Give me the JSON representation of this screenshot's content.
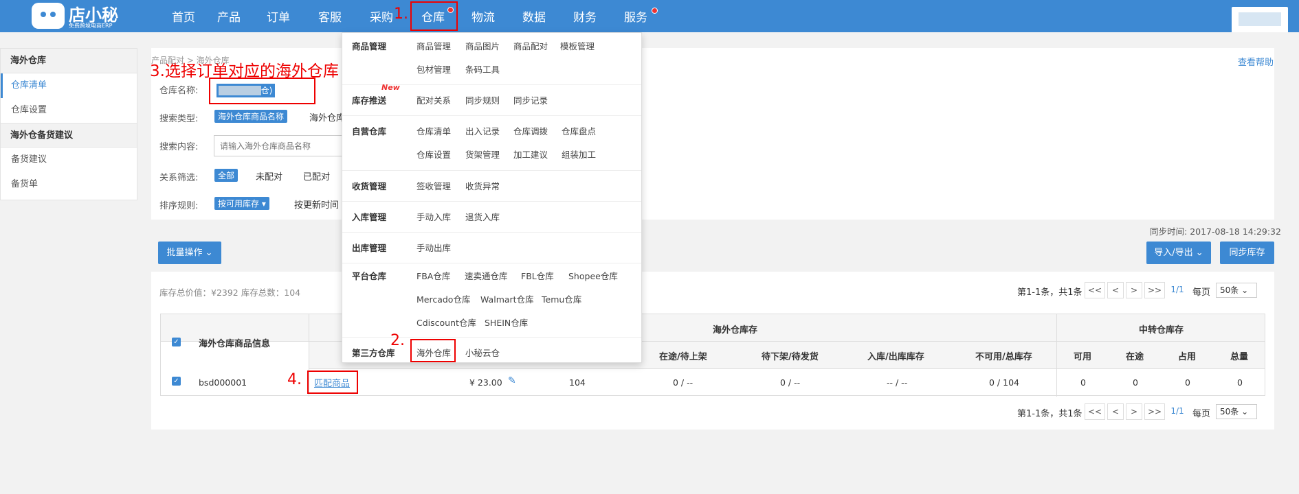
{
  "brand": {
    "name": "店小秘",
    "tagline": "免费跨境电商ERP"
  },
  "nav": {
    "items": [
      "首页",
      "产品",
      "订单",
      "客服",
      "采购",
      "仓库",
      "物流",
      "数据",
      "财务",
      "服务"
    ]
  },
  "sidebar": {
    "groups": [
      {
        "title": "海外仓库",
        "items": [
          "仓库清单",
          "仓库设置"
        ]
      },
      {
        "title": "海外仓备货建议",
        "items": [
          "备货建议",
          "备货单"
        ]
      }
    ]
  },
  "breadcrumb": "产品配对 > 海外仓库",
  "help": "查看帮助",
  "filters": {
    "warehouse_label": "仓库名称:",
    "warehouse_value": "(俄罗斯仓)",
    "search_type_label": "搜索类型:",
    "search_type_active": "海外仓库商品名称",
    "search_type_other": "海外仓库",
    "search_content_label": "搜索内容:",
    "search_placeholder": "请输入海外仓库商品名称",
    "relation_label": "关系筛选:",
    "relation_options": [
      "全部",
      "未配对",
      "已配对"
    ],
    "sort_label": "排序规则:",
    "sort_active": "按可用库存 ▾",
    "sort_other": "按更新时间"
  },
  "annotations": {
    "step1": "1.",
    "step2": "2.",
    "step3": "3.选择订单对应的海外仓库",
    "step4": "4."
  },
  "sync": {
    "label": "同步时间:",
    "time": "2017-08-18 14:29:32"
  },
  "actions": {
    "batch": "批量操作 ⌄",
    "import_export": "导入/导出 ⌄",
    "sync_stock": "同步库存"
  },
  "summary": "库存总价值：¥2392  库存总数：104",
  "pager": {
    "info": "第1-1条，共1条",
    "first": "<<",
    "prev": "<",
    "next": ">",
    "last": ">>",
    "current": "1/1",
    "per_page_label": "每页",
    "per_page": "50条 ⌄"
  },
  "table": {
    "header_product": "海外仓库商品信息",
    "group_overseas": "海外仓库存",
    "group_transit": "中转仓库存",
    "sub_overseas": [
      "在途/待上架",
      "待下架/待发货",
      "入库/出库库存",
      "不可用/总库存"
    ],
    "sub_transit": [
      "可用",
      "在途",
      "占用",
      "总量"
    ],
    "rows": [
      {
        "sku": "bsd000001",
        "match": "匹配商品",
        "price": "¥ 23.00",
        "available": "104",
        "in_transit": "0 / --",
        "pending": "0 / --",
        "in_out": "-- / --",
        "unavailable_total": "0 / 104",
        "t_available": "0",
        "t_transit": "0",
        "t_occupied": "0",
        "t_total": "0"
      }
    ]
  },
  "dropdown": {
    "sections": [
      {
        "title": "商品管理",
        "rows": [
          [
            "商品管理",
            "商品图片",
            "商品配对",
            "模板管理"
          ],
          [
            "包材管理",
            "条码工具"
          ]
        ]
      },
      {
        "title": "库存推送",
        "badge": "New",
        "rows": [
          [
            "配对关系",
            "同步规则",
            "同步记录"
          ]
        ]
      },
      {
        "title": "自营仓库",
        "rows": [
          [
            "仓库清单",
            "出入记录",
            "仓库调拨",
            "仓库盘点"
          ],
          [
            "仓库设置",
            "货架管理",
            "加工建议",
            "组装加工"
          ]
        ]
      },
      {
        "title": "收货管理",
        "rows": [
          [
            "签收管理",
            "收货异常"
          ]
        ]
      },
      {
        "title": "入库管理",
        "rows": [
          [
            "手动入库",
            "退货入库"
          ]
        ]
      },
      {
        "title": "出库管理",
        "rows": [
          [
            "手动出库"
          ]
        ]
      },
      {
        "title": "平台仓库",
        "rows": [
          [
            "FBA仓库",
            "速卖通仓库",
            "FBL仓库",
            "Shopee仓库"
          ],
          [
            "Mercado仓库",
            "Walmart仓库",
            "Temu仓库"
          ],
          [
            "Cdiscount仓库",
            "SHEIN仓库"
          ]
        ]
      },
      {
        "title": "第三方仓库",
        "rows": [
          [
            "海外仓库",
            "小秘云仓"
          ]
        ]
      }
    ]
  },
  "colors": {
    "primary": "#3d89d3",
    "annotation": "#e00000",
    "badge": "#e33333"
  }
}
